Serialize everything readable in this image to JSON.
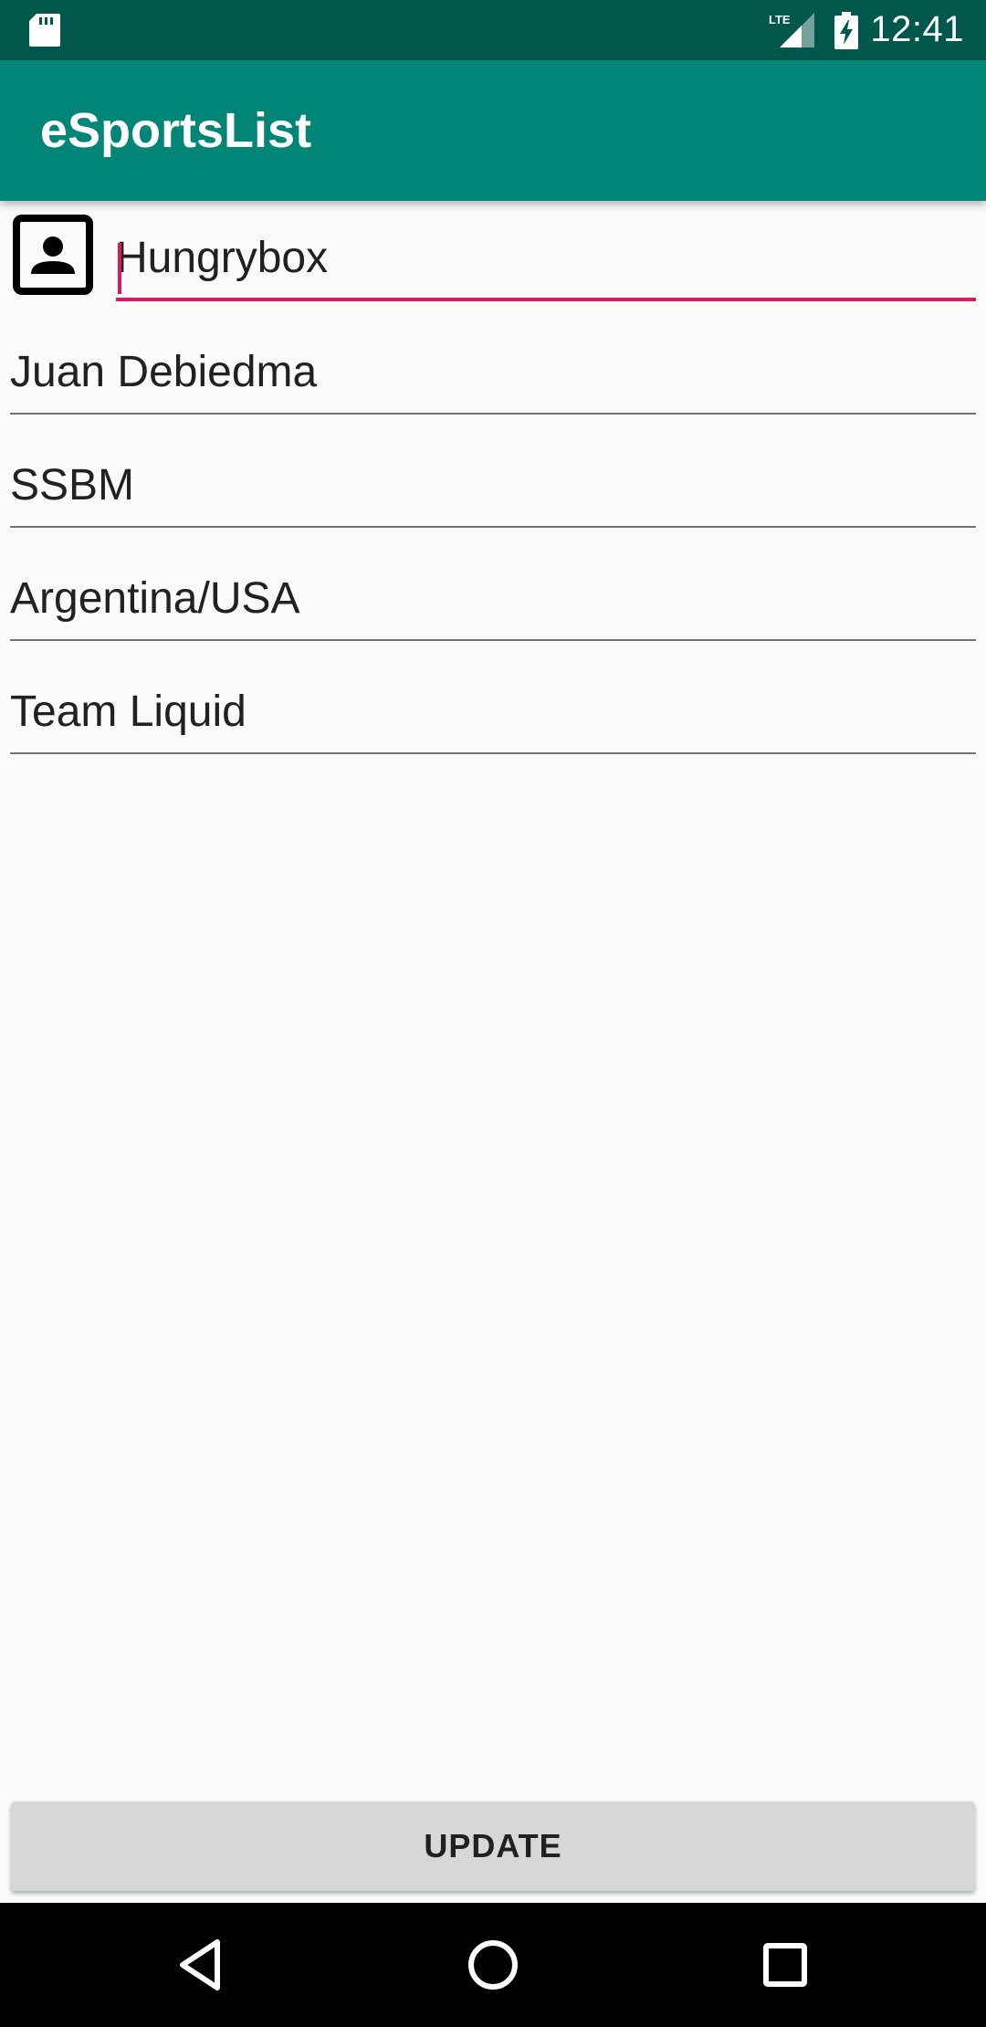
{
  "status_bar": {
    "time": "12:41",
    "network_label": "LTE",
    "icons": [
      "sd-card-icon",
      "lte-signal-icon",
      "battery-charging-icon"
    ]
  },
  "app_bar": {
    "title": "eSportsList"
  },
  "form": {
    "icon": "contact-card-icon",
    "fields": [
      {
        "value": "Hungrybox",
        "focused": true
      },
      {
        "value": "Juan Debiedma",
        "focused": false
      },
      {
        "value": "SSBM",
        "focused": false
      },
      {
        "value": "Argentina/USA",
        "focused": false
      },
      {
        "value": "Team Liquid",
        "focused": false
      }
    ]
  },
  "update_button": {
    "label": "UPDATE"
  },
  "nav_bar": {
    "icons": [
      "back-icon",
      "home-icon",
      "recents-icon"
    ]
  },
  "colors": {
    "status_bar": "#00574b",
    "app_bar": "#008577",
    "accent": "#d81b60",
    "background": "#fafafa",
    "button": "#d6d7d7"
  }
}
